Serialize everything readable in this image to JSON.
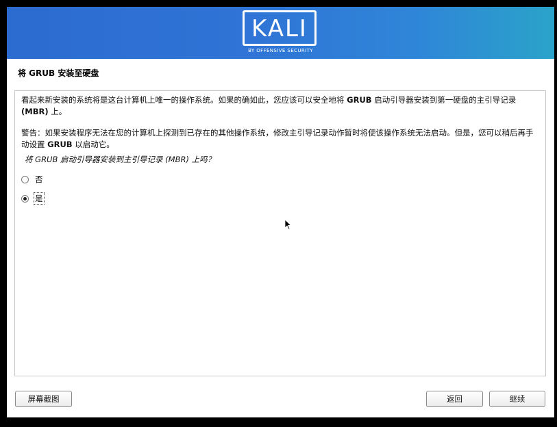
{
  "banner": {
    "logo_text": "KALI",
    "logo_tagline": "BY OFFENSIVE SECURITY"
  },
  "page": {
    "title": "将 GRUB 安装至硬盘"
  },
  "content": {
    "para1_a": "看起来新安装的系统将是这台计算机上唯一的操作系统。如果的确如此，您应该可以安全地将 ",
    "para1_b": "GRUB",
    "para1_c": " 启动引导器安装到第一硬盘的主引导记录 ",
    "para1_d": "(MBR)",
    "para1_e": " 上。",
    "para2_a": "警告：如果安装程序无法在您的计算机上探测到已存在的其他操作系统，修改主引导记录动作暂时将使该操作系统无法启动。但是，您可以稍后再手动设置 ",
    "para2_b": "GRUB",
    "para2_c": " 以启动它。",
    "question": "将 GRUB 启动引导器安装到主引导记录 (MBR) 上吗？",
    "options": [
      {
        "label": "否",
        "selected": false
      },
      {
        "label": "是",
        "selected": true
      }
    ]
  },
  "buttons": {
    "screenshot": "屏幕截图",
    "back": "返回",
    "continue": "继续"
  },
  "colors": {
    "banner_start": "#2c6bd0",
    "banner_end": "#2aa3c9"
  }
}
